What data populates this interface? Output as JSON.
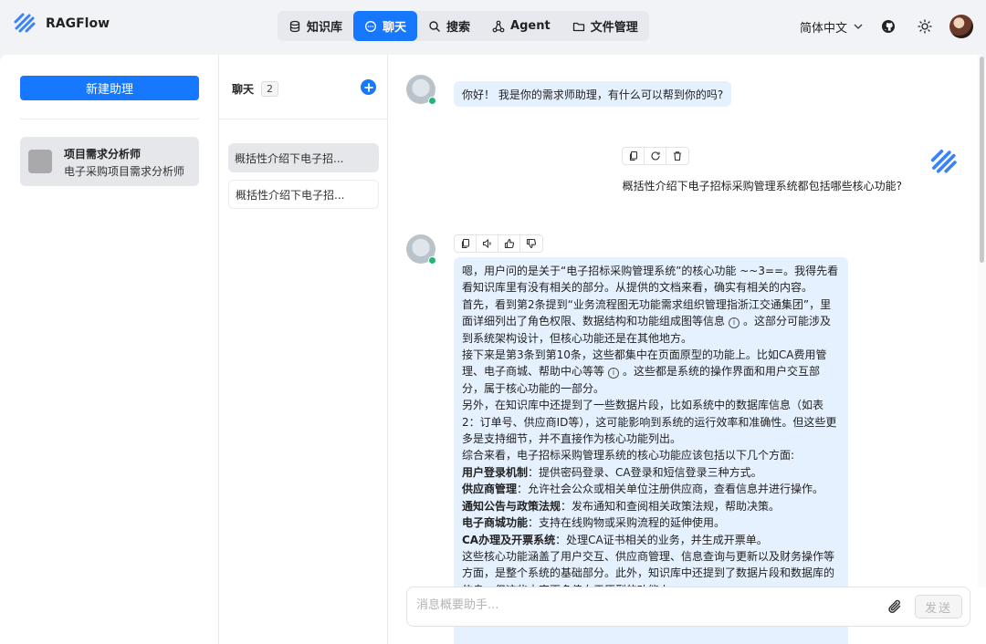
{
  "header": {
    "app_name": "RAGFlow",
    "nav": [
      {
        "label": "知识库",
        "icon": "database-icon"
      },
      {
        "label": "聊天",
        "icon": "chat-bubble-icon",
        "active": true
      },
      {
        "label": "搜索",
        "icon": "search-icon"
      },
      {
        "label": "Agent",
        "icon": "agent-graph-icon"
      },
      {
        "label": "文件管理",
        "icon": "folder-icon"
      }
    ],
    "language": "简体中文",
    "accent_color": "#1677ff"
  },
  "sidebar": {
    "new_assistant_label": "新建助理",
    "assistants": [
      {
        "name": "项目需求分析师",
        "description": "电子采购项目需求分析师"
      }
    ]
  },
  "chats": {
    "title": "聊天",
    "count": "2",
    "items": [
      {
        "label": "概括性介绍下电子招..."
      },
      {
        "label": "概括性介绍下电子招..."
      }
    ]
  },
  "conversation": {
    "greeting": "你好！ 我是你的需求师助理，有什么可以帮到你的吗?",
    "user_question": "概括性介绍下电子招标采购管理系统都包括哪些核心功能?",
    "answer_paragraphs": [
      "嗯，用户问的是关于“电子招标采购管理系统”的核心功能 ~~3==。我得先看看知识库里有没有相关的部分。从提供的文档来看，确实有相关的内容。",
      "首先，看到第2条提到“业务流程图无功能需求组织管理指浙江交通集团”，里面详细列出了角色权限、数据结构和功能组成图等信息",
      "。这部分可能涉及到系统架构设计，但核心功能还是在其他地方。",
      "接下来是第3条到第10条，这些都集中在页面原型的功能上。比如CA费用管理、电子商城、帮助中心等等",
      "。这些都是系统的操作界面和用户交互部分，属于核心功能的一部分。",
      "另外，在知识库中还提到了一些数据片段，比如系统中的数据库信息（如表2：订单号、供应商ID等），这可能影响到系统的运行效率和准确性。但这些更多是支持细节，并不直接作为核心功能列出。",
      "综合来看，电子招标采购管理系统的核心功能应该包括以下几个方面:"
    ],
    "answer_features": [
      {
        "name": "用户登录机制",
        "text": "：提供密码登录、CA登录和短信登录三种方式。"
      },
      {
        "name": "供应商管理",
        "text": "：允许社会公众或相关单位注册供应商，查看信息并进行操作。"
      },
      {
        "name": "通知公告与政策法规",
        "text": "：发布通知和查阅相关政策法规，帮助决策。"
      },
      {
        "name": "电子商城功能",
        "text": "：支持在线购物或采购流程的延伸使用。"
      },
      {
        "name": "CA办理及开票系统",
        "text": "：处理CA证书相关的业务，并生成开票单。"
      }
    ],
    "answer_tail": "这些核心功能涵盖了用户交互、供应商管理、信息查询与更新以及财务操作等方面，是整个系统的基础部分。此外，知识库中还提到了数据片段和数据库的信息，但这些内容更多偏向于原型的功能上。",
    "citation_marker": "i"
  },
  "composer": {
    "placeholder": "消息概要助手...",
    "send_label": "发送"
  }
}
